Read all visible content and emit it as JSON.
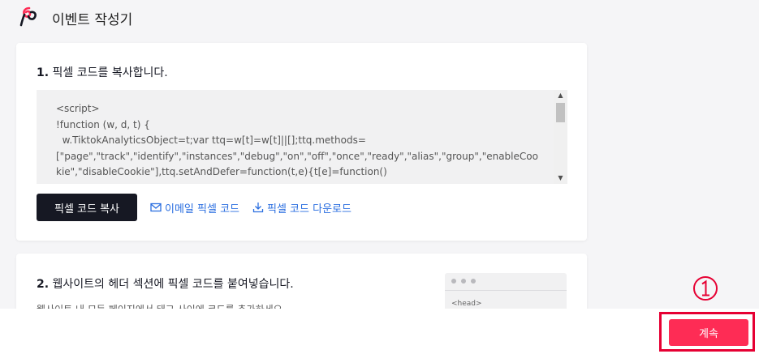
{
  "header": {
    "title": "이벤트 작성기",
    "logo_icon": "tiktok-pixel-logo"
  },
  "step1": {
    "number": "1.",
    "title": " 픽셀 코드를 복사합니다.",
    "code": "<script>\n!function (w, d, t) {\n  w.TiktokAnalyticsObject=t;var ttq=w[t]=w[t]||[];ttq.methods=\n[\"page\",\"track\",\"identify\",\"instances\",\"debug\",\"on\",\"off\",\"once\",\"ready\",\"alias\",\"group\",\"enableCookie\",\"disableCookie\"],ttq.setAndDefer=function(t,e){t[e]=function()",
    "copy_button": "픽셀 코드 복사",
    "email_link": "이메일 픽셀 코드",
    "download_link": "픽셀 코드 다운로드"
  },
  "step2": {
    "number": "2.",
    "title": " 웹사이트의 헤더 섹션에 픽셀 코드를 붙여넣습니다.",
    "subtext": "웹사이트 내 모든 페이지에서 태그 사이에 코드를 추가하세요.",
    "preview_head": "<head>"
  },
  "annotation": {
    "marker": "①",
    "color": "#e60033"
  },
  "footer": {
    "continue_button": "계속"
  },
  "colors": {
    "accent": "#fe2c55",
    "link": "#2a6ee0",
    "dark_button": "#161823"
  }
}
